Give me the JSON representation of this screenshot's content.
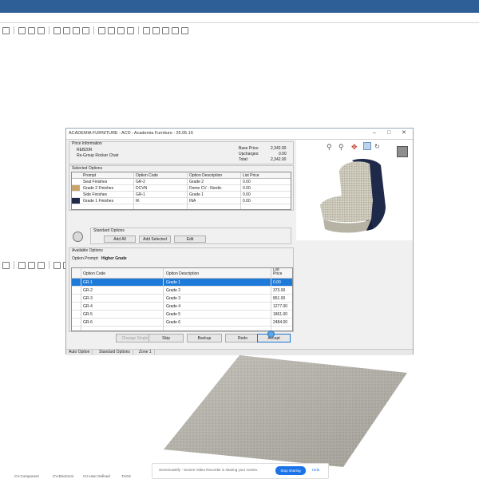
{
  "dialog": {
    "title": "ACADEMIA FURNITURE : ACD : Academia Furniture : 25.05.16",
    "price_info": {
      "legend": "Price Information",
      "code": "REB20R",
      "description": "Re-Group Rocker Chair",
      "base_price_label": "Base Price:",
      "base_price": "2,342.00",
      "upcharges_label": "Upcharges:",
      "upcharges": "0.00",
      "total_label": "Total:",
      "total": "2,342.00"
    },
    "selected_options": {
      "legend": "Selected Options",
      "headers": [
        "Prompt",
        "Option Code",
        "Option Description",
        "List Price"
      ],
      "rows": [
        {
          "prompt": "Seat Finishes",
          "code": "GR-2",
          "desc": "Grade 2",
          "price": "0.00"
        },
        {
          "prompt": "Grade 2 Finishes",
          "code": "DCVN",
          "desc": "Dome CV - Nordic",
          "price": "0.00"
        },
        {
          "prompt": "Side Finishes",
          "code": "GR-1",
          "desc": "Grade 1",
          "price": "0.00"
        },
        {
          "prompt": "Grade 1 Finishes",
          "code": "IK",
          "desc": "INA",
          "price": "0.00"
        }
      ]
    },
    "standard_options": {
      "legend": "Standard Options",
      "add_all": "Add All",
      "add_selected": "Add Selected",
      "edit": "Edit"
    },
    "available_options": {
      "legend": "Available Options",
      "prompt_label": "Option Prompt:",
      "prompt_value": "Higher Grade",
      "headers": [
        "Option Code",
        "Option Description",
        "List Price"
      ],
      "rows": [
        {
          "code": "GR-1",
          "desc": "Grade 1",
          "price": "0.00"
        },
        {
          "code": "GR-2",
          "desc": "Grade 2",
          "price": "373.00"
        },
        {
          "code": "GR-3",
          "desc": "Grade 3",
          "price": "851.00"
        },
        {
          "code": "GR-4",
          "desc": "Grade 4",
          "price": "1277.00"
        },
        {
          "code": "GR-5",
          "desc": "Grade 5",
          "price": "1861.00"
        },
        {
          "code": "GR-6",
          "desc": "Grade 6",
          "price": "2484.00"
        }
      ]
    },
    "buttons": {
      "change_single": "Change Single",
      "skip": "Skip",
      "backup": "Backup",
      "redo": "Redo",
      "accept": "Accept"
    },
    "tabs": [
      "Auto Option",
      "Standard Options",
      "Zone 1"
    ]
  },
  "share_bar": {
    "message": "Screencastify - Screen Video Recorder is sharing your screen.",
    "stop": "Stop sharing",
    "hide": "Hide"
  },
  "statusbar": [
    "CV-Component",
    "CV-Electrical",
    "CV-User Defined",
    "TAGS"
  ],
  "colors": {
    "title_bar": "#2e5f96",
    "selection": "#1e7ad8",
    "chair_fabric": "#c9c6b8",
    "chair_frame": "#1f2a4a"
  }
}
